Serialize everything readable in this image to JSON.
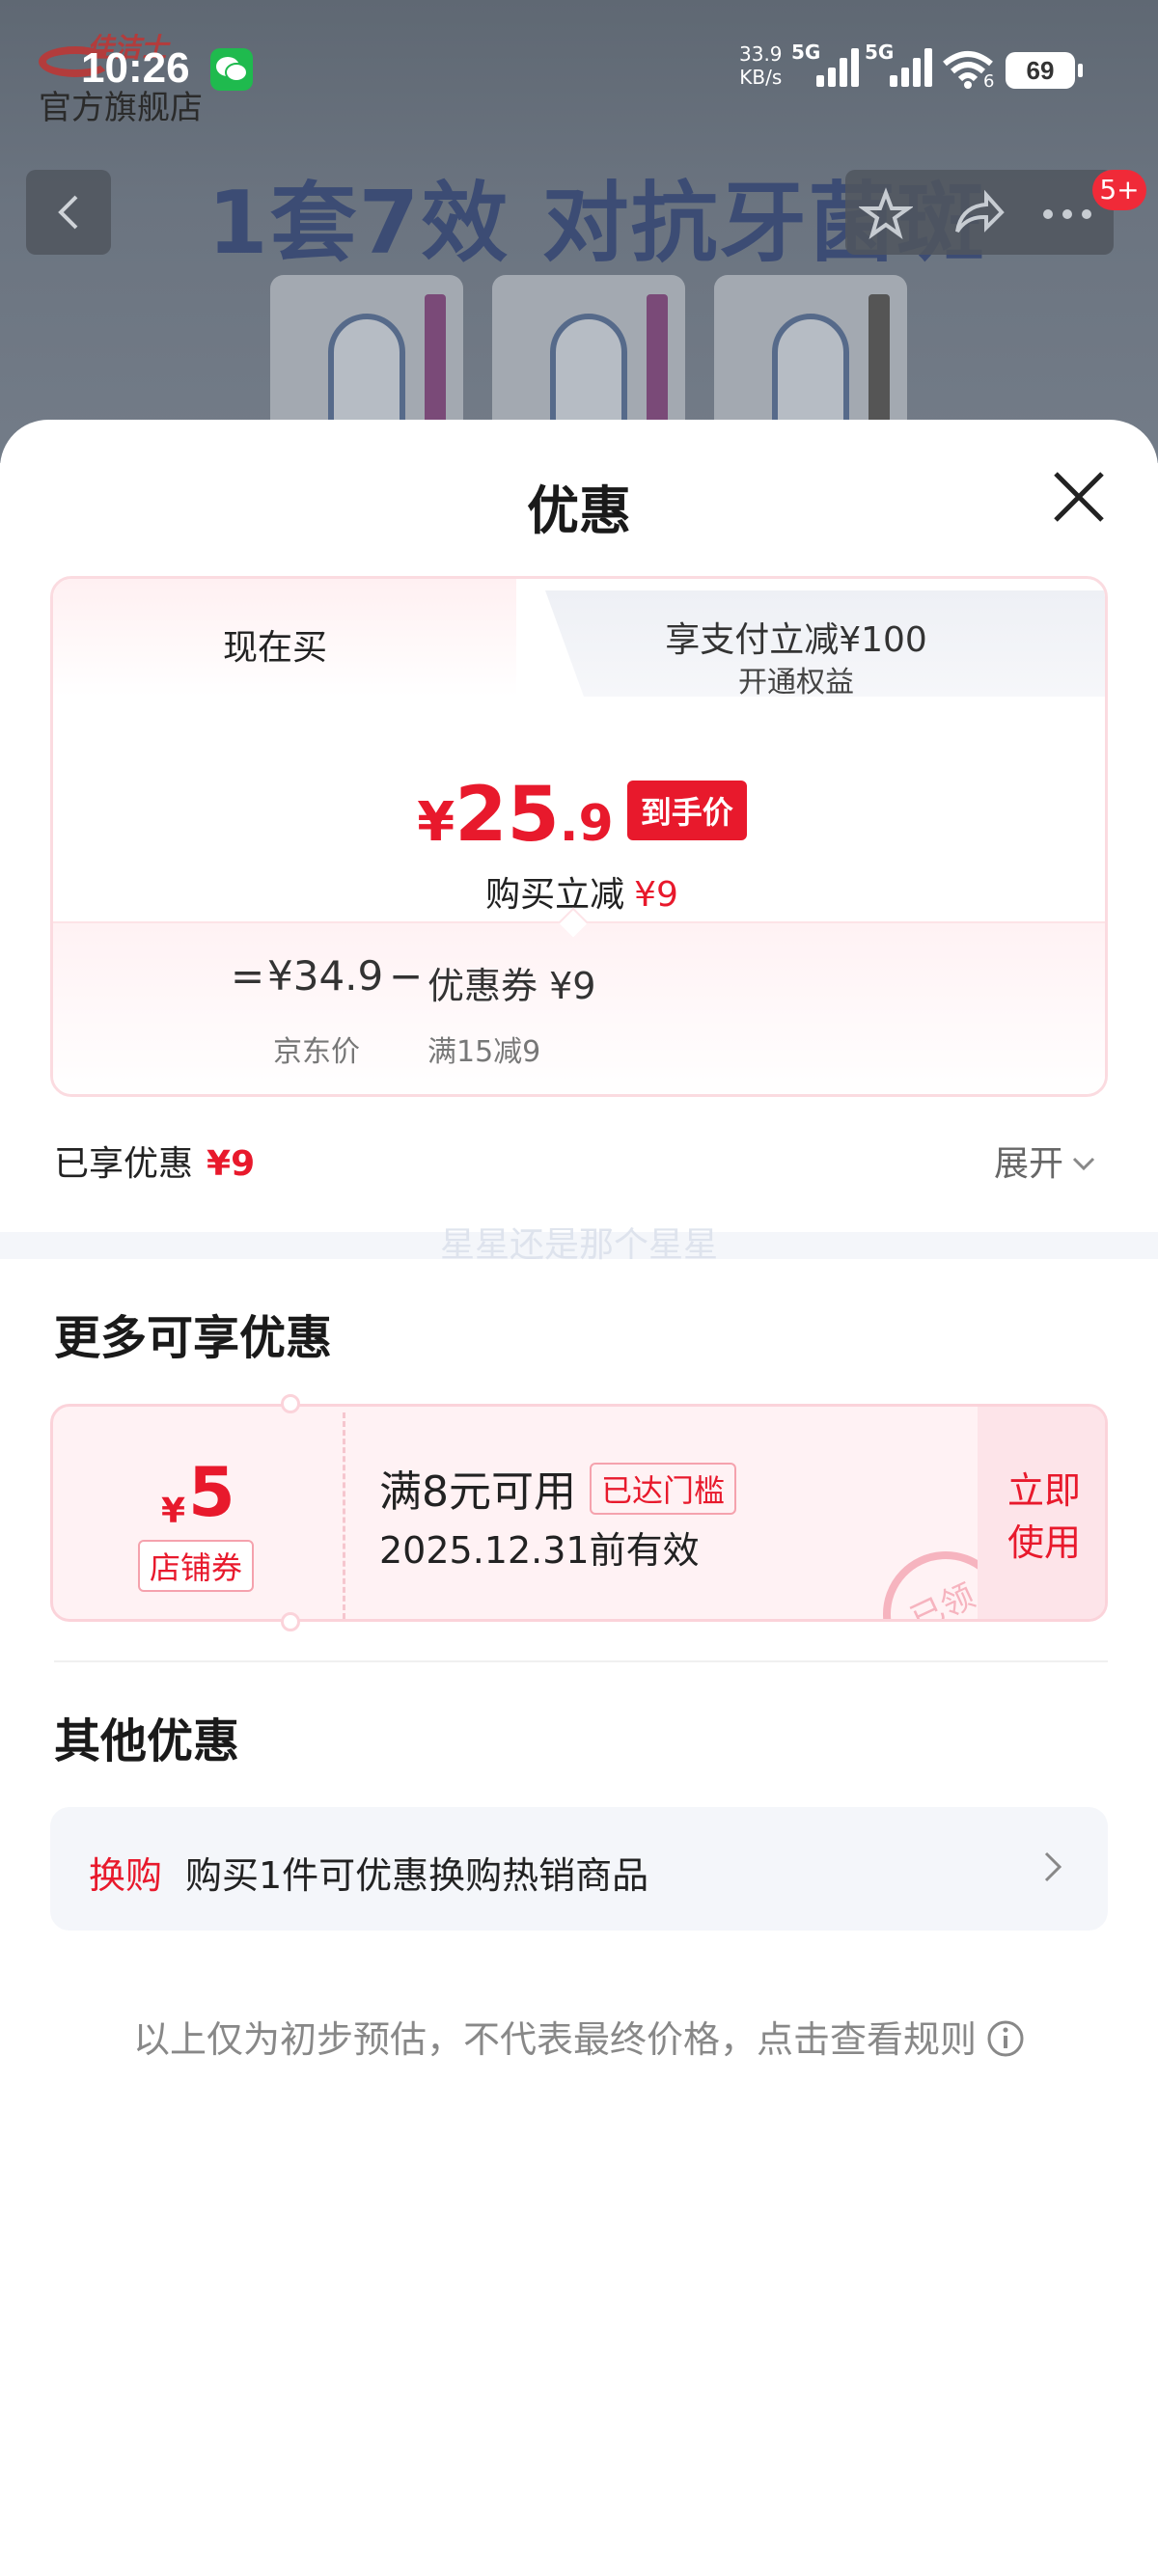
{
  "status_bar": {
    "time": "10:26",
    "net_speed": "33.9",
    "net_unit": "KB/s",
    "signal1": "5G",
    "signal2": "5G",
    "wifi_label": "6",
    "battery": "69"
  },
  "background": {
    "brand_top": "佳洁士",
    "brand_bottom": "官方旗舰店",
    "banner": "1套7效 对抗牙菌斑",
    "badge": "5+"
  },
  "sheet": {
    "title": "优惠",
    "tabs": {
      "active": "现在买",
      "other_main": "享支付立减¥100",
      "other_sub": "开通权益"
    },
    "price": {
      "yen": "¥",
      "int": "25",
      "dec": ".9",
      "tag": "到手价",
      "buy_cut_label": "购买立减",
      "buy_cut_value": "¥9"
    },
    "formula": {
      "eq": "=",
      "jd_price": "¥34.9",
      "minus": "−",
      "coupon": "优惠券 ¥9",
      "jd_label": "京东价",
      "coupon_label": "满15减9"
    },
    "enjoyed": {
      "label": "已享优惠",
      "value": "¥9"
    },
    "expand": "展开",
    "watermark": "星星还是那个星星",
    "more_title": "更多可享优惠",
    "coupon_card": {
      "yen": "¥",
      "amount": "5",
      "type": "店铺券",
      "condition": "满8元可用",
      "reached": "已达门槛",
      "expiry": "2025.12.31前有效",
      "use_line1": "立即",
      "use_line2": "使用",
      "stamp": "已领"
    },
    "other_title": "其他优惠",
    "swap": {
      "tag": "换购",
      "text": "购买1件可优惠换购热销商品"
    },
    "disclaimer": "以上仅为初步预估，不代表最终价格，点击查看规则"
  },
  "colors": {
    "accent": "#e8192c",
    "tab_bg": "#eef0f5"
  }
}
